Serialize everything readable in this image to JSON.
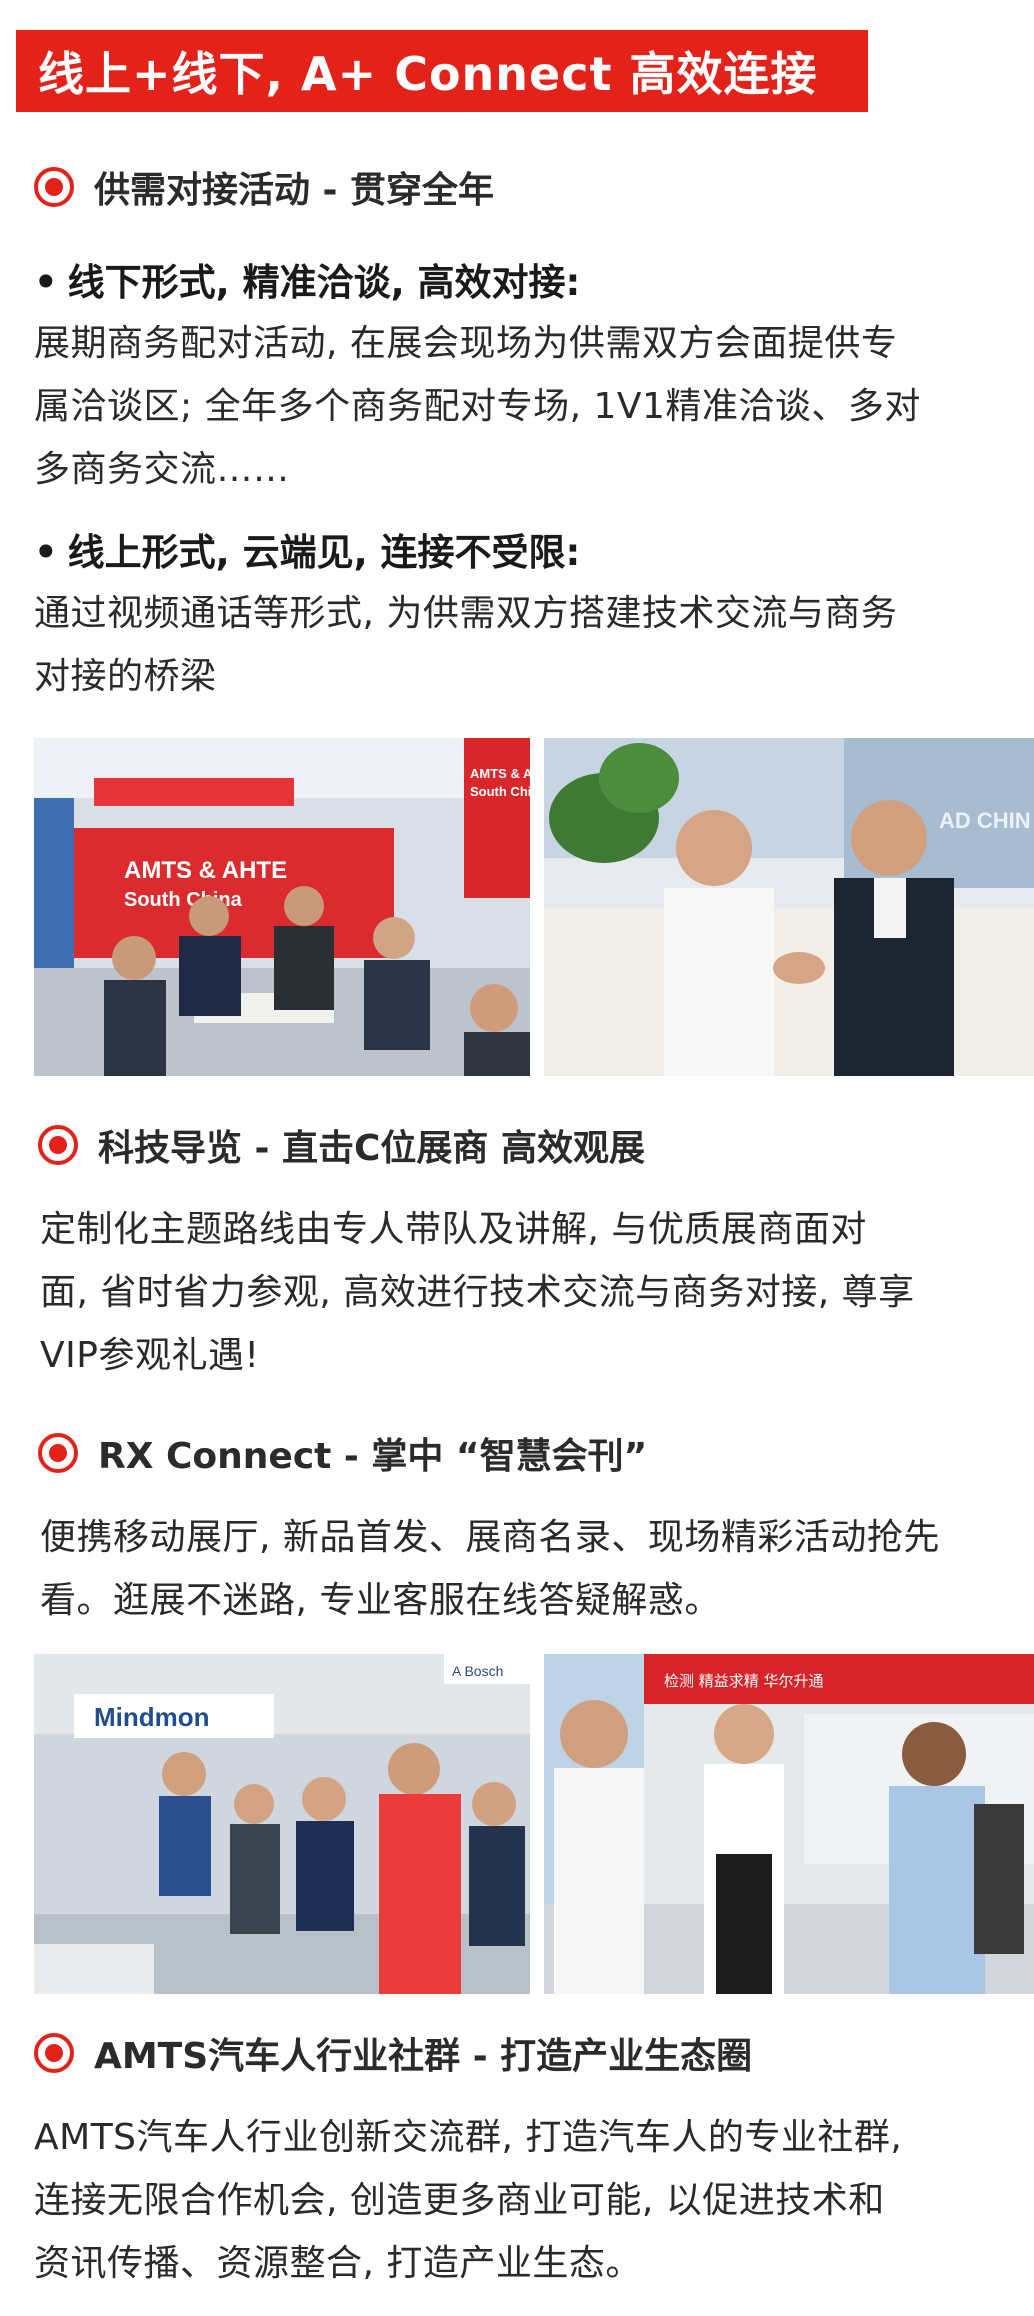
{
  "banner": {
    "title": "线上+线下, A+ Connect 高效连接"
  },
  "sections": [
    {
      "heading": "供需对接活动 - 贯穿全年",
      "bullets": [
        {
          "title": "线下形式, 精准洽谈, 高效对接:",
          "lines": [
            "展期商务配对活动, 在展会现场为供需双方会面提供专",
            "属洽谈区; 全年多个商务配对专场, 1V1精准洽谈、多对",
            "多商务交流……"
          ]
        },
        {
          "title": "线上形式, 云端见, 连接不受限:",
          "lines": [
            "通过视频通话等形式, 为供需双方搭建技术交流与商务",
            "对接的桥梁"
          ]
        }
      ]
    },
    {
      "heading": "科技导览 - 直击C位展商 高效观展",
      "lines": [
        "定制化主题路线由专人带队及讲解, 与优质展商面对",
        "面, 省时省力参观, 高效进行技术交流与商务对接, 尊享",
        "VIP参观礼遇!"
      ]
    },
    {
      "heading": "RX Connect - 掌中 “智慧会刊”",
      "lines": [
        "便携移动展厅, 新品首发、展商名录、现场精彩活动抢先",
        "看。逛展不迷路, 专业客服在线答疑解惑。"
      ]
    },
    {
      "heading": "AMTS汽车人行业社群 - 打造产业生态圈",
      "lines": [
        "AMTS汽车人行业创新交流群, 打造汽车人的专业社群,",
        "连接无限合作机会, 创造更多商业可能, 以促进技术和",
        "资讯传播、资源整合, 打造产业生态。"
      ]
    }
  ],
  "photos": {
    "photo1_sign": "AMTS & AHTE",
    "photo1_sign_sub": "South China",
    "photo1_banner": "AMTS & AHTE",
    "photo1_banner_sub": "South Chi",
    "photo2_wall": "AD CHIN",
    "photo3_brand": "Mindmon",
    "photo3_brand2": "A Bosch",
    "photo4_banner": "检测    精益求精    华尔升通"
  },
  "colors": {
    "accent": "#e32219",
    "text": "#2a2a2a"
  }
}
